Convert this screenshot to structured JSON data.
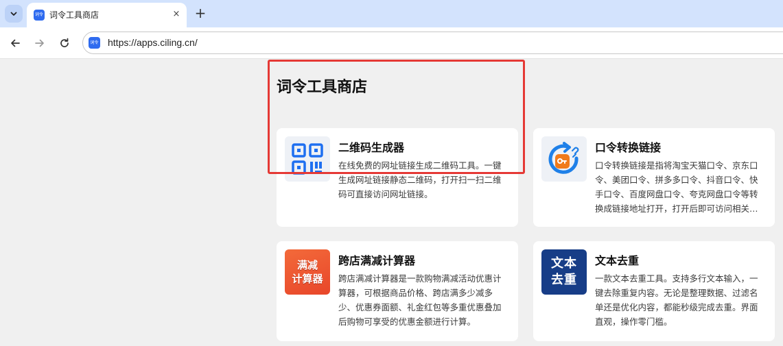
{
  "browser": {
    "tab": {
      "favicon_text": "词令",
      "title": "词令工具商店",
      "close_symbol": "×"
    },
    "new_tab_symbol": "+",
    "url": "https://apps.ciling.cn/",
    "site_icon_text": "词令"
  },
  "page": {
    "title": "词令工具商店",
    "highlight_color": "#e53935",
    "cards": [
      {
        "icon": "qr-code-icon",
        "title": "二维码生成器",
        "description": "在线免费的网址链接生成二维码工具。一键生成网址链接静态二维码，打开扫一扫二维码可直接访问网址链接。"
      },
      {
        "icon": "link-convert-icon",
        "title": "口令转换链接",
        "description": "口令转换链接是指将淘宝天猫口令、京东口令、美团口令、拼多多口令、抖音口令、快手口令、百度网盘口令、夸克网盘口令等转换成链接地址打开，打开后即可访问相关内容。"
      },
      {
        "icon": "calculator-tile-icon",
        "thumb_text": [
          "满减",
          "计算器"
        ],
        "title": "跨店满减计算器",
        "description": "跨店满减计算器是一款购物满减活动优惠计算器，可根据商品价格、跨店满多少减多少、优惠券面额、礼金红包等多重优惠叠加后购物可享受的优惠金额进行计算。"
      },
      {
        "icon": "text-dedup-tile-icon",
        "thumb_text": [
          "文本",
          "去重"
        ],
        "title": "文本去重",
        "description": "一款文本去重工具。支持多行文本输入，一键去除重复内容。无论是整理数据、过滤名单还是优化内容，都能秒级完成去重。界面直观，操作零门槛。"
      }
    ]
  }
}
